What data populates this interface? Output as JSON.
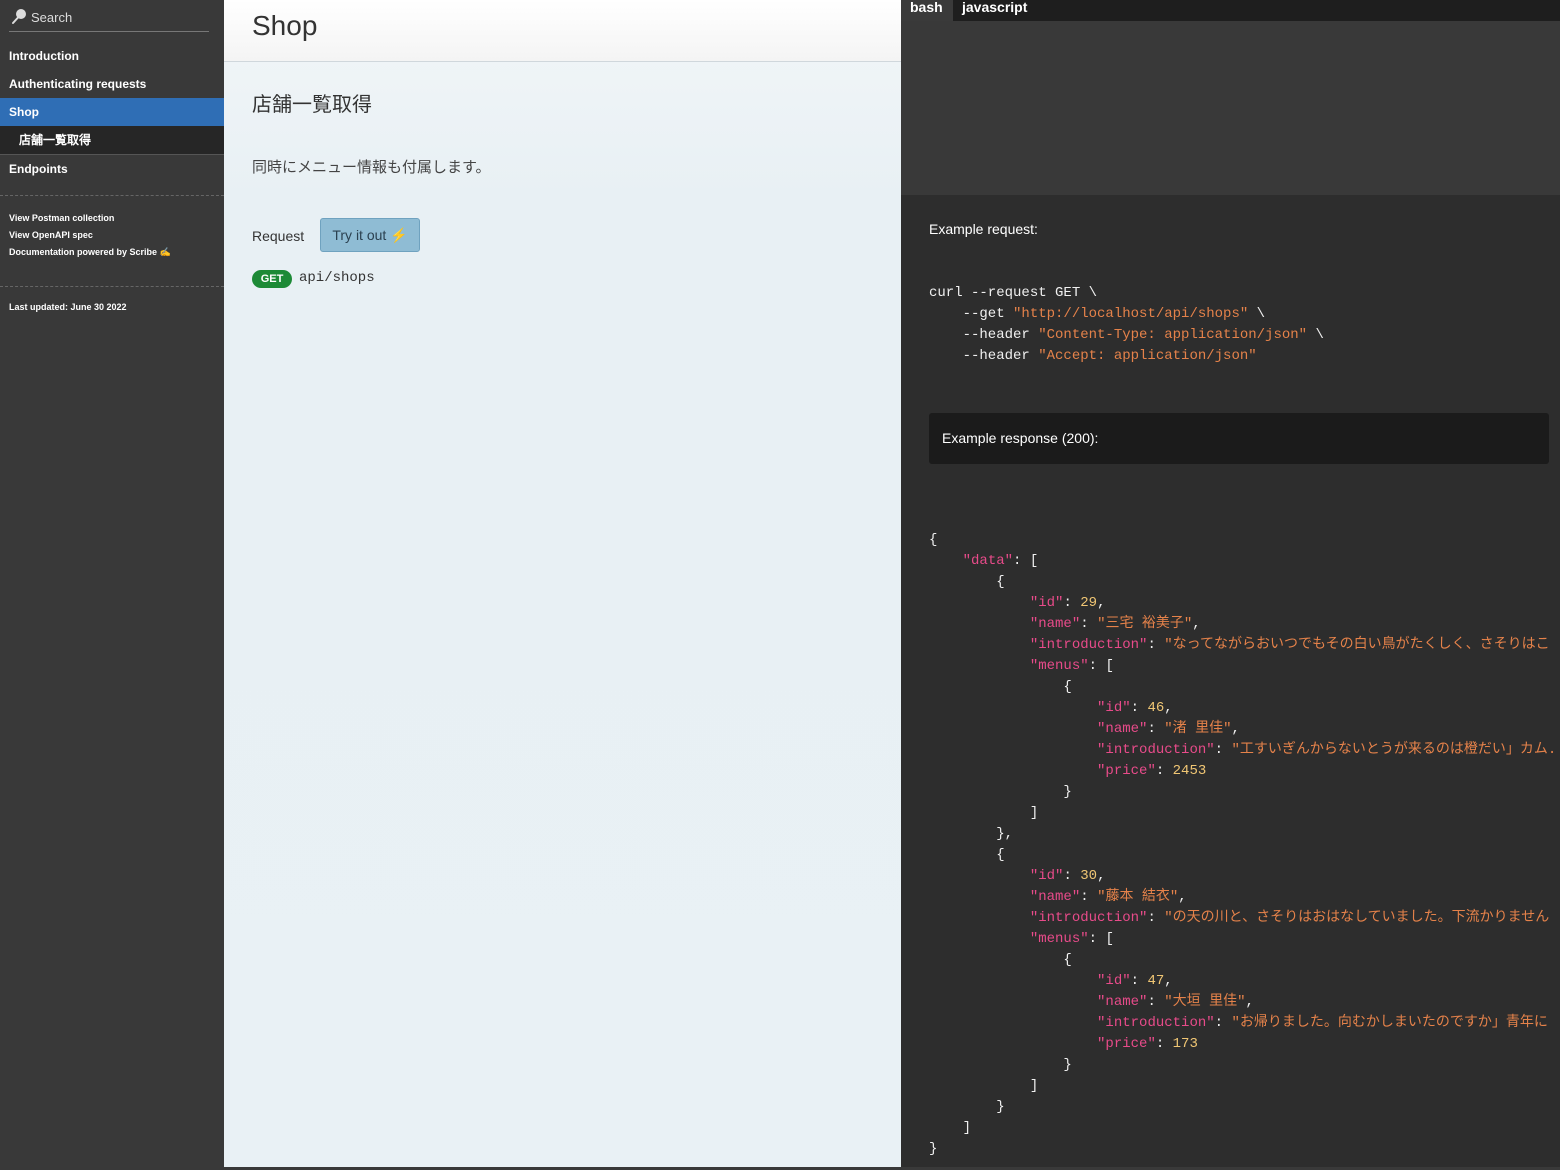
{
  "sidebar": {
    "search_placeholder": "Search",
    "nav": {
      "introduction": "Introduction",
      "auth": "Authenticating requests",
      "shop": "Shop",
      "shop_sub": "店舗一覧取得",
      "endpoints": "Endpoints"
    },
    "links": {
      "postman": "View Postman collection",
      "openapi": "View OpenAPI spec",
      "powered": "Documentation powered by Scribe ✍"
    },
    "last_updated": "Last updated: June 30 2022"
  },
  "main": {
    "title": "Shop",
    "section_title": "店舗一覧取得",
    "description": "同時にメニュー情報も付属します。",
    "request_label": "Request",
    "try_button": "Try it out ⚡",
    "method": "GET",
    "path": "api/shops"
  },
  "code_panel": {
    "tabs": [
      "bash",
      "javascript"
    ],
    "example_request_label": "Example request:",
    "curl_lines": {
      "l1": "curl --request GET \\",
      "l2_flag": "    --get ",
      "l2_str": "\"http://localhost/api/shops\"",
      "l2_end": " \\",
      "l3_flag": "    --header ",
      "l3_str": "\"Content-Type: application/json\"",
      "l3_end": " \\",
      "l4_flag": "    --header ",
      "l4_str": "\"Accept: application/json\""
    },
    "example_response_label": "Example response (200):",
    "response": {
      "shops": [
        {
          "id": "29",
          "name": "\"三宅 裕美子\"",
          "introduction": "\"なってながらおいつでもその白い鳥がたくしく、さそりはこ",
          "menu": {
            "id": "46",
            "name": "\"渚 里佳\"",
            "introduction": "\"工すいぎんからないとうが来るのは橙だい」カム.",
            "price": "2453"
          }
        },
        {
          "id": "30",
          "name": "\"藤本 結衣\"",
          "introduction": "\"の天の川と、さそりはおはなしていました。下流かりません",
          "menu": {
            "id": "47",
            "name": "\"大垣 里佳\"",
            "introduction": "\"お帰りました。向むかしまいたのですか」青年に",
            "price": "173"
          }
        }
      ]
    }
  }
}
